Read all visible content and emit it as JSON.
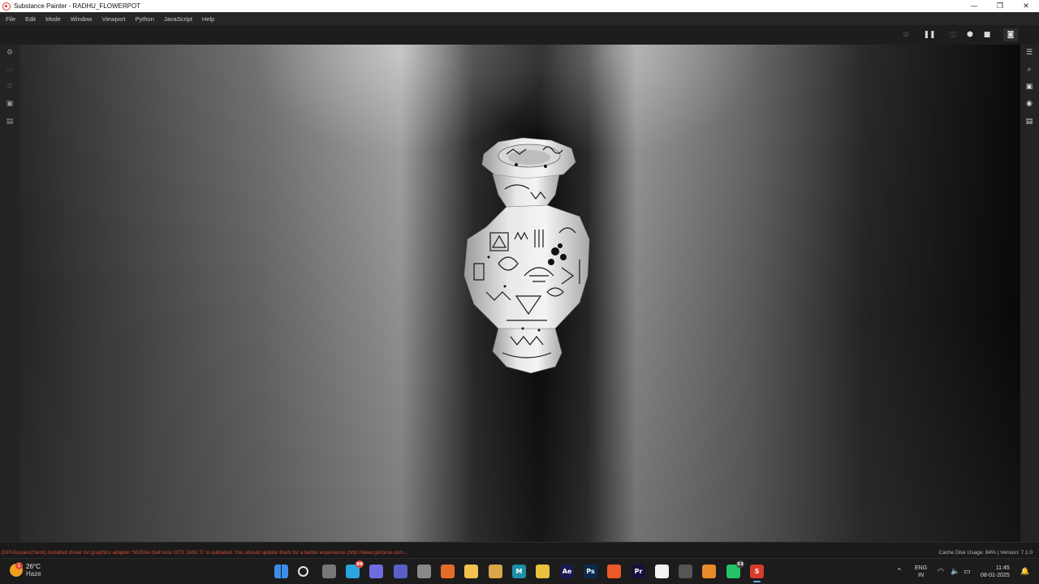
{
  "window": {
    "title": "Substance Painter - RADHU_FLOWERPOT",
    "minimize": "—",
    "restore": "❐",
    "close": "✕"
  },
  "menu": [
    "File",
    "Edit",
    "Mode",
    "Window",
    "Viewport",
    "Python",
    "JavaScript",
    "Help"
  ],
  "viewport_toolbar": {
    "icons": [
      "hide-mesh-icon",
      "pause-icon",
      "split-view-icon",
      "3d-view-icon",
      "camera-icon",
      "screenshot-icon"
    ]
  },
  "left_tools": [
    "settings-icon",
    "clone-stamp-icon",
    "gear-icon",
    "photoshop-icon",
    "file-icon"
  ],
  "right_dock": [
    "layers-panel-icon",
    "zoom-icon",
    "display-settings-icon",
    "shader-settings-icon",
    "texture-set-icon"
  ],
  "status": {
    "log": "[GPUIssuesCheck] Installed driver for graphics adapter 'NVIDIA GeForce GTX 1660 Ti' is outdated. You should update them for a better experience (http://www.geforce.com...",
    "cache": "Cache Disk Usage:   84% | Version: 7.1.0"
  },
  "taskbar": {
    "weather": {
      "temp": "26°C",
      "condition": "Haze",
      "badge": "1"
    },
    "apps": [
      {
        "name": "windows-start-icon",
        "label": "",
        "color": "#3b8fe8"
      },
      {
        "name": "search-icon",
        "label": "",
        "color": "transparent"
      },
      {
        "name": "task-view-icon",
        "label": "",
        "color": "#777777"
      },
      {
        "name": "telegram-icon",
        "label": "",
        "color": "#2aa3de",
        "badge": "99"
      },
      {
        "name": "copilot-icon",
        "label": "",
        "color": "#6d6de0"
      },
      {
        "name": "teams-icon",
        "label": "",
        "color": "#5b5fc7"
      },
      {
        "name": "settings-icon",
        "label": "",
        "color": "#888888"
      },
      {
        "name": "firefox-icon",
        "label": "",
        "color": "#e66b2a"
      },
      {
        "name": "file-explorer-icon",
        "label": "",
        "color": "#f2c14e"
      },
      {
        "name": "blender-cycles-icon",
        "label": "",
        "color": "#d9a64a"
      },
      {
        "name": "maya-icon",
        "label": "M",
        "color": "#1a8fa6"
      },
      {
        "name": "chrome-icon",
        "label": "",
        "color": "#e8c33b"
      },
      {
        "name": "after-effects-icon",
        "label": "Ae",
        "color": "#1a1a52"
      },
      {
        "name": "photoshop-icon",
        "label": "Ps",
        "color": "#0c2a4e"
      },
      {
        "name": "brave-icon",
        "label": "",
        "color": "#ec5a2a"
      },
      {
        "name": "premiere-icon",
        "label": "Pr",
        "color": "#1b0f3d"
      },
      {
        "name": "adobe-icon",
        "label": "",
        "color": "#f2f2f2"
      },
      {
        "name": "unity-hub-icon",
        "label": "",
        "color": "#555555"
      },
      {
        "name": "blender-icon",
        "label": "",
        "color": "#e88a2a"
      },
      {
        "name": "whatsapp-icon",
        "label": "",
        "color": "#25c266",
        "badge": "53"
      },
      {
        "name": "substance-painter-icon",
        "label": "S",
        "color": "#d83b2b"
      }
    ],
    "language": {
      "line1": "ENG",
      "line2": "IN"
    },
    "time": "11:45",
    "date": "08-01-2025"
  }
}
